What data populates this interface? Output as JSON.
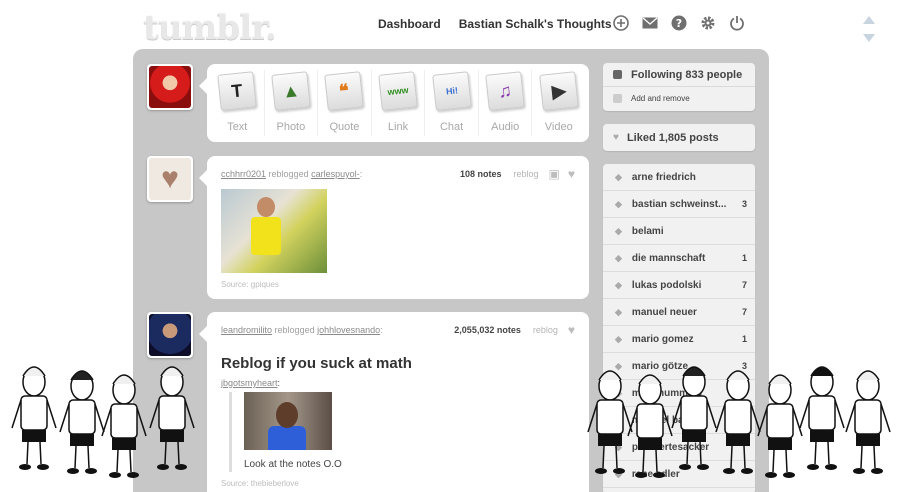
{
  "header": {
    "logo": "tumblr.",
    "nav": [
      "Dashboard",
      "Bastian Schalk's Thoughts"
    ],
    "icons": [
      "plus-circle-icon",
      "mail-icon",
      "help-icon",
      "gear-icon",
      "power-icon"
    ]
  },
  "post_types": [
    {
      "label": "Text",
      "glyph": "T",
      "icon": "text-post-icon"
    },
    {
      "label": "Photo",
      "glyph": "▲",
      "icon": "photo-post-icon"
    },
    {
      "label": "Quote",
      "glyph": "❝",
      "icon": "quote-post-icon"
    },
    {
      "label": "Link",
      "glyph": "www",
      "icon": "link-post-icon"
    },
    {
      "label": "Chat",
      "glyph": "Hi!",
      "icon": "chat-post-icon"
    },
    {
      "label": "Audio",
      "glyph": "♫",
      "icon": "audio-post-icon"
    },
    {
      "label": "Video",
      "glyph": "▶",
      "icon": "video-post-icon"
    }
  ],
  "post1": {
    "user": "cchhrr0201",
    "action": "reblogged",
    "from": "carlespuyol-",
    "notes": "108 notes",
    "reblog": "reblog",
    "source": "Source: gpiques"
  },
  "post2": {
    "user": "leandromilito",
    "action": "reblogged",
    "from": "johhlovesnando",
    "notes": "2,055,032 notes",
    "reblog": "reblog",
    "title": "Reblog if you suck at math",
    "quoter": "jbgotsmyheart",
    "caption": "Look at the notes O.O",
    "source": "Source: thebieberlove"
  },
  "sidebar": {
    "following": "Following 833 people",
    "add_remove": "Add and remove",
    "liked": "Liked 1,805 posts",
    "tags": [
      {
        "name": "arne friedrich",
        "count": ""
      },
      {
        "name": "bastian schweinst...",
        "count": "3"
      },
      {
        "name": "belami",
        "count": ""
      },
      {
        "name": "die mannschaft",
        "count": "1"
      },
      {
        "name": "lukas podolski",
        "count": "7"
      },
      {
        "name": "manuel neuer",
        "count": "7"
      },
      {
        "name": "mario gomez",
        "count": "1"
      },
      {
        "name": "mario götze",
        "count": "3"
      },
      {
        "name": "mats hummels",
        "count": ""
      },
      {
        "name": "michael ballack",
        "count": ""
      },
      {
        "name": "per mertesacker",
        "count": ""
      },
      {
        "name": "rene adler",
        "count": ""
      }
    ]
  }
}
